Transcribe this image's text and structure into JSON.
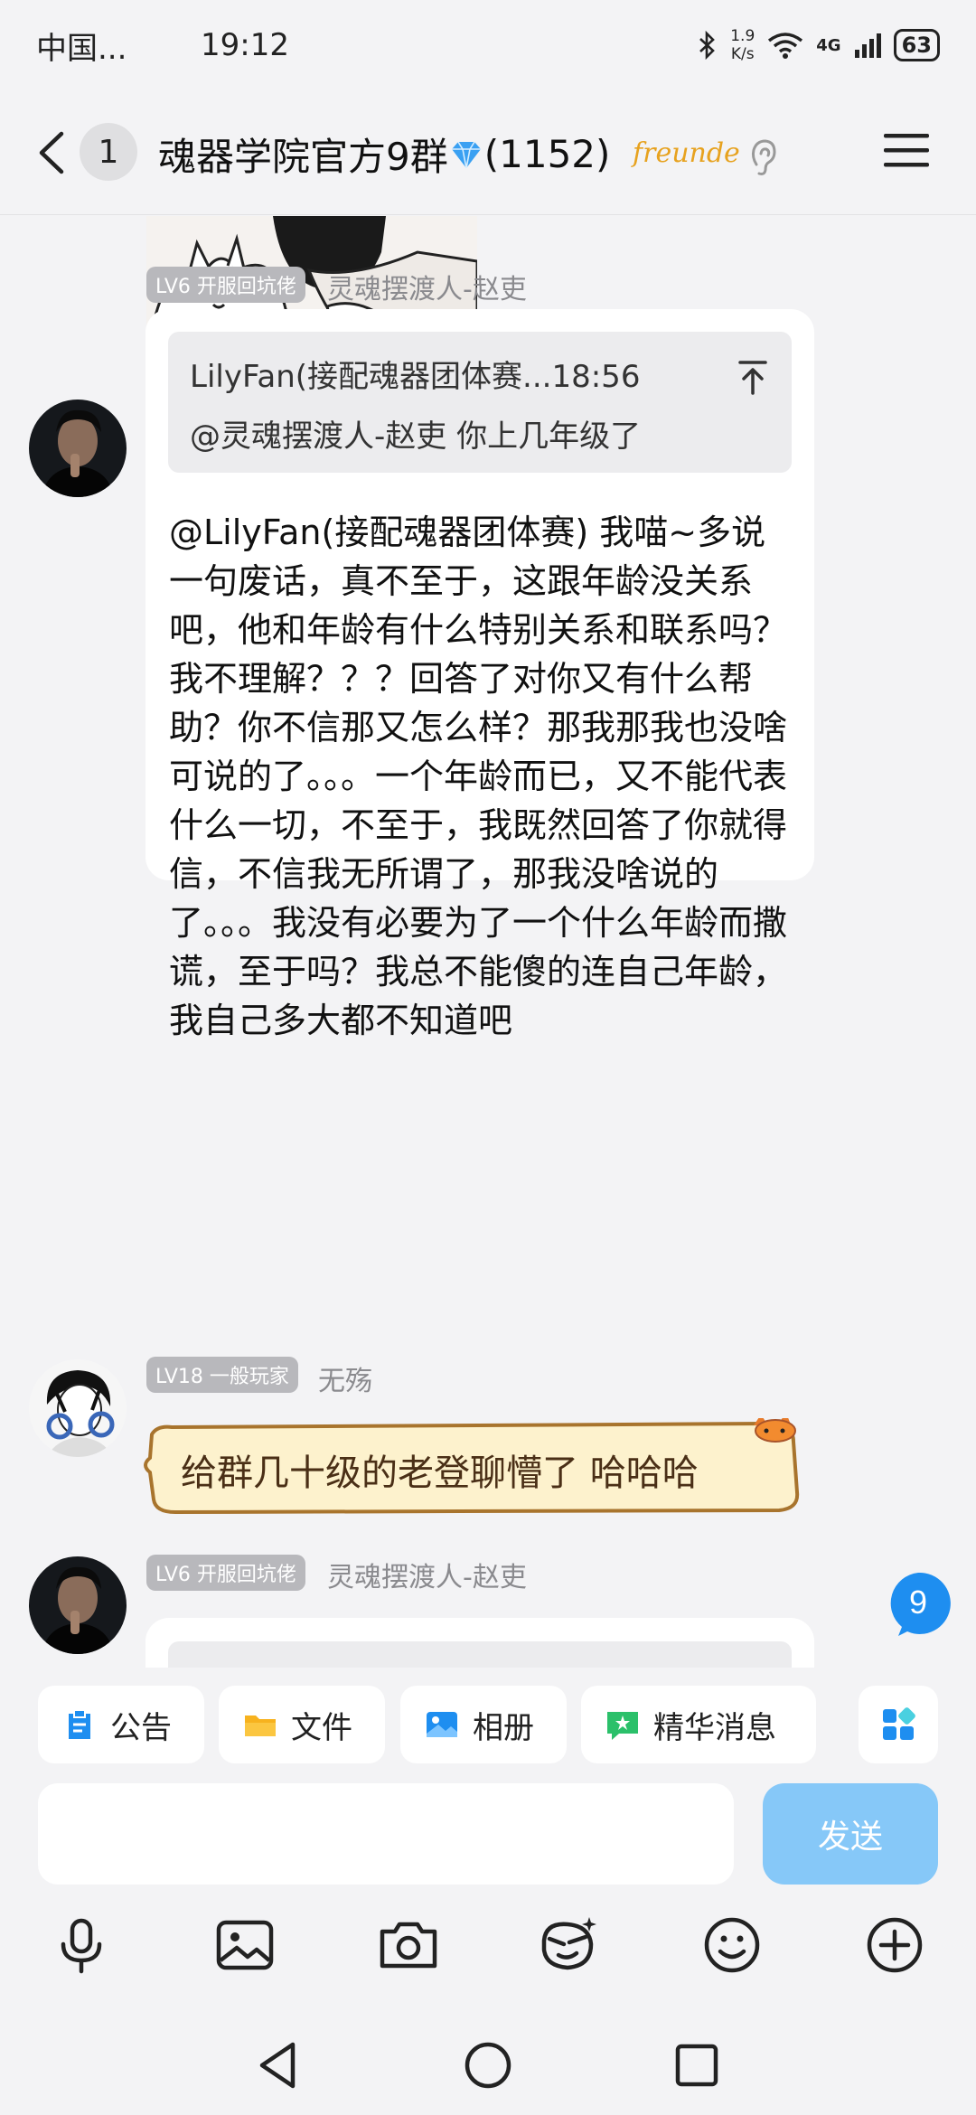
{
  "status_bar": {
    "carrier": "中国...",
    "time": "19:12",
    "net_speed_value": "1.9",
    "net_speed_unit": "K/s",
    "network": "4G",
    "battery": "63"
  },
  "header": {
    "unread_count": "1",
    "group_name": "魂器学院官方9群",
    "member_count": "(1152)",
    "brand_tag": "freunde"
  },
  "messages": [
    {
      "type": "image",
      "description_icon": "cartoon-cat-image"
    },
    {
      "type": "reply",
      "level_badge": "LV6 开服回坑佬",
      "nickname": "灵魂摆渡人-赵吏",
      "quote_header": "LilyFan(接配魂器团体赛...18:56",
      "quote_text": "@灵魂摆渡人-赵吏 你上几年级了",
      "text": "@LilyFan(接配魂器团体赛) 我喵~多说一句废话，真不至于，这跟年龄没关系吧，他和年龄有什么特别关系和联系吗？我不理解？？？回答了对你又有什么帮助？你不信那又怎么样？那我那我也没啥可说的了。。。一个年龄而已，又不能代表什么一切，不至于，我既然回答了你就得信，不信我无所谓了，那我没啥说的了。。。我没有必要为了一个什么年龄而撒谎，至于吗？我总不能傻的连自己年龄，我自己多大都不知道吧"
    },
    {
      "type": "text",
      "level_badge": "LV18 一般玩家",
      "nickname": "无殇",
      "text": "给群几十级的老登聊懵了 哈哈哈"
    },
    {
      "type": "reply",
      "level_badge": "LV6 开服回坑佬",
      "nickname": "灵魂摆渡人-赵吏"
    }
  ],
  "new_message_badge": "9",
  "quick_actions": [
    {
      "label": "公告",
      "icon": "announcement-icon"
    },
    {
      "label": "文件",
      "icon": "folder-icon"
    },
    {
      "label": "相册",
      "icon": "album-icon"
    },
    {
      "label": "精华消息",
      "icon": "essence-icon"
    }
  ],
  "composer": {
    "placeholder": "",
    "send_label": "发送"
  },
  "colors": {
    "send_button": "#86c8f8",
    "level_badge": "#b8b8bc",
    "accent_blue": "#1e8ef0"
  }
}
